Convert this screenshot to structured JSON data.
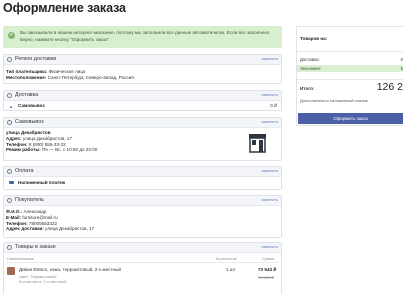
{
  "page": {
    "title": "Оформление заказа",
    "notice": "Вы заказывали в нашем интернет-магазине, поэтому мы заполнили все данные автоматически. Если все заполнено верно, нажмите кнопку \"Оформить заказ\"."
  },
  "region": {
    "header": "Регион доставки",
    "change": "изменить",
    "payer_type_label": "Тип плательщика:",
    "payer_type_value": "Физическое лицо",
    "location_label": "Местоположение:",
    "location_value": "Санкт-Петербург, Северо-Запад, Россия"
  },
  "delivery": {
    "header": "Доставка",
    "change": "изменить",
    "method": "Самовывоз",
    "price": "0 ₽"
  },
  "pickup": {
    "header": "Самовывоз",
    "change": "изменить",
    "name": "улица Декабристов",
    "address_label": "Адрес:",
    "address_value": "улица Декабристов, 17",
    "phone_label": "Телефон:",
    "phone_value": "8 (800) 555-33-22",
    "hours_label": "Режим работы:",
    "hours_value": "Пн — Вс. с 10:00 до 22:00"
  },
  "payment": {
    "header": "Оплата",
    "change": "изменить",
    "method": "Наложенный платеж"
  },
  "buyer": {
    "header": "Покупатель",
    "change": "изменить",
    "name_label": "Ф.И.О.:",
    "name_value": "Александр",
    "email_label": "E-Mail:",
    "email_value": "furniture@mail.ru",
    "phone_label": "Телефон:",
    "phone_value": "78005553322",
    "address_label": "Адрес доставки:",
    "address_value": "улица Декабристов, 17"
  },
  "cart": {
    "header": "Товары в заказе",
    "change": "изменить",
    "col_name": "Наименование",
    "col_qty": "Количество",
    "col_sum": "Сумма",
    "item_name": "Диван Elesco, кожа, терракотовый, 2-х местный",
    "item_prop1": "Цвет: Терракотовый",
    "item_prop2": "Кол-во мест: 2-х местный",
    "item_qty": "1 шт",
    "item_sum": "73 543 ₽",
    "item_old_sum": "79 000 ₽"
  },
  "summary": {
    "title": "Товаров на:",
    "delivery_label": "Доставка:",
    "delivery_value": "0",
    "saving_label": "Экономия:",
    "saving_value": "5",
    "total_label": "Итого:",
    "total_value": "126 2",
    "cod_note": "Дополнительно наложенный платеж",
    "order_button": "Оформить заказ"
  },
  "colors": {
    "accent": "#4b5fa6",
    "notice_bg": "#d8efcf",
    "link": "#5b7fc2"
  }
}
